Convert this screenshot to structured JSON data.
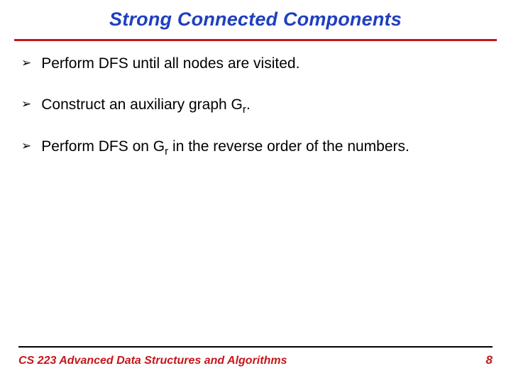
{
  "title": "Strong Connected Components",
  "bullets": [
    {
      "pre": "Perform DFS until all nodes are visited.",
      "sub": "",
      "post": ""
    },
    {
      "pre": "Construct an auxiliary graph G",
      "sub": "r",
      "post": "."
    },
    {
      "pre": "Perform DFS on G",
      "sub": "r",
      "post": " in the reverse order of the numbers."
    }
  ],
  "footer": {
    "course": "CS 223 Advanced Data Structures and Algorithms",
    "page": "8"
  },
  "icons": {
    "bullet_glyph": "➢"
  }
}
